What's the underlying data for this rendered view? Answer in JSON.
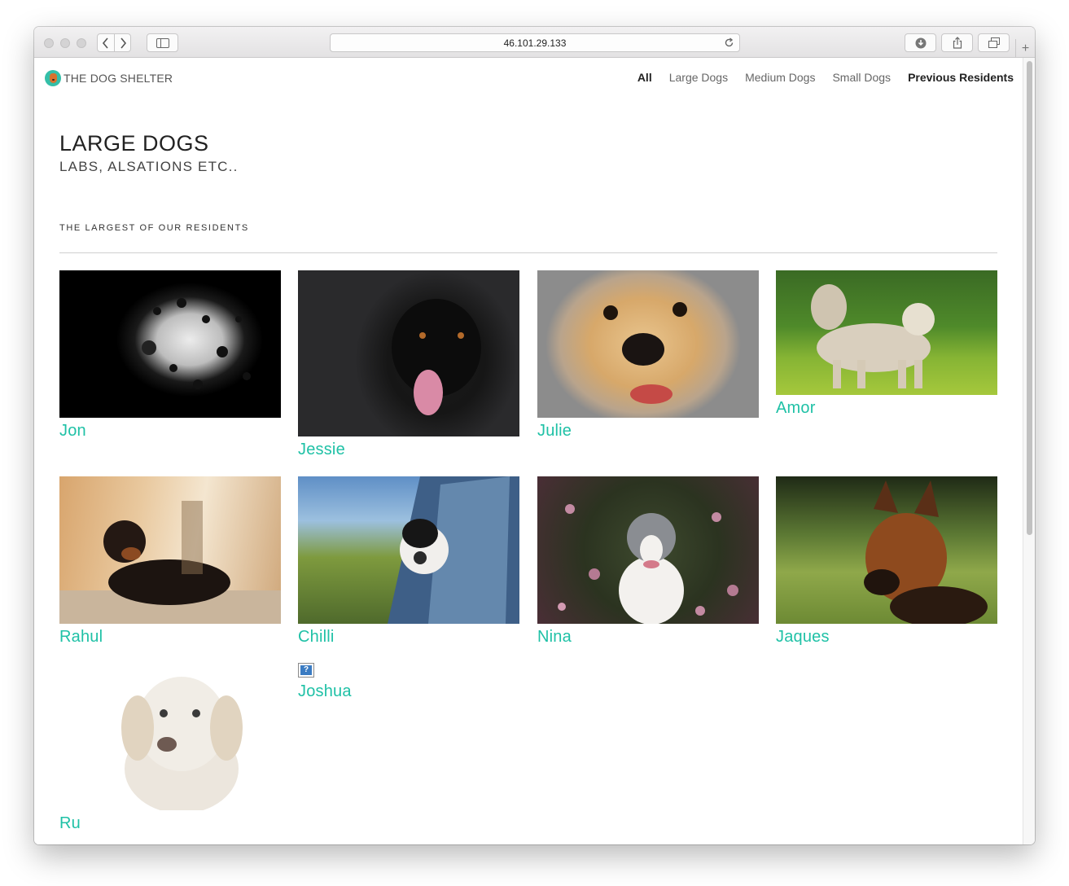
{
  "browser": {
    "url": "46.101.29.133"
  },
  "site": {
    "brand": "THE DOG SHELTER",
    "nav": [
      {
        "label": "All"
      },
      {
        "label": "Large Dogs"
      },
      {
        "label": "Medium Dogs"
      },
      {
        "label": "Small Dogs"
      },
      {
        "label": "Previous Residents"
      }
    ]
  },
  "page": {
    "title": "LARGE DOGS",
    "subtitle": "LABS, ALSATIONS ETC..",
    "tagline": "THE LARGEST OF OUR RESIDENTS"
  },
  "dogs": [
    {
      "name": "Jon",
      "photo": "dalmatian-photo"
    },
    {
      "name": "Jessie",
      "photo": "black-retriever-photo"
    },
    {
      "name": "Julie",
      "photo": "golden-retriever-photo"
    },
    {
      "name": "Amor",
      "photo": "husky-photo"
    },
    {
      "name": "Rahul",
      "photo": "rottweiler-photo"
    },
    {
      "name": "Chilli",
      "photo": "boston-terrier-car-photo"
    },
    {
      "name": "Nina",
      "photo": "pitbull-flowers-photo"
    },
    {
      "name": "Jaques",
      "photo": "german-shepherd-photo"
    },
    {
      "name": "Ru",
      "photo": "white-retriever-photo"
    },
    {
      "name": "Joshua",
      "photo": "broken-image"
    }
  ],
  "colors": {
    "accent": "#1fc1a6",
    "logo": "#34bfa8"
  }
}
